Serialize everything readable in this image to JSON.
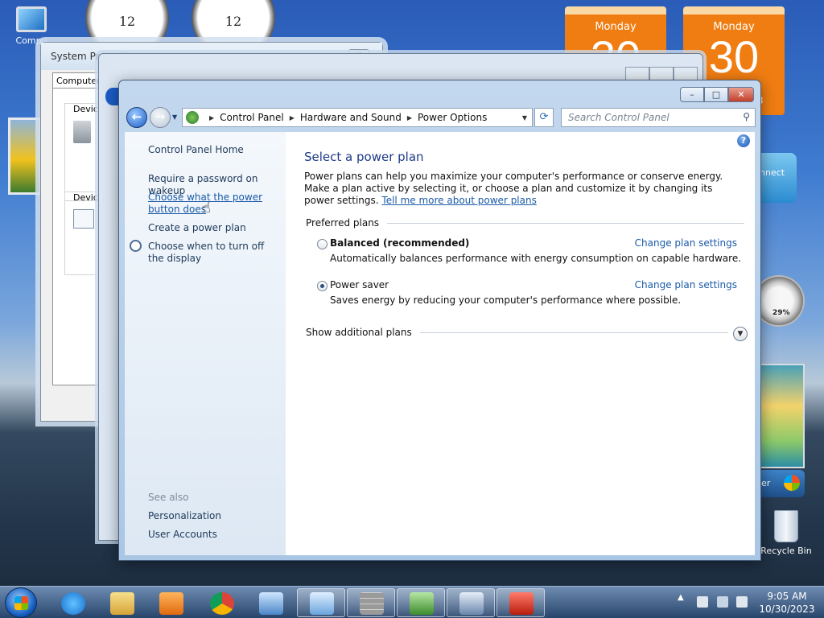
{
  "desktop": {
    "computer_label": "Compu",
    "recycle_label": "Recycle Bin",
    "clock1_num": "12",
    "clock2_num": "12",
    "calendar1": {
      "day": "Monday",
      "date": "30"
    },
    "calendar2": {
      "day": "Monday",
      "date": "30"
    },
    "calendar_fragment": "3",
    "connect_label": "nnect",
    "gauge_text": "29%",
    "media_label": "er"
  },
  "system_properties": {
    "title": "System Properties",
    "tab": "Computer N",
    "group1": "Device",
    "group2": "Device"
  },
  "window": {
    "caption": {
      "minimize": "–",
      "maximize": "□",
      "close": "✕"
    },
    "address": {
      "crumbs": [
        "Control Panel",
        "Hardware and Sound",
        "Power Options"
      ]
    },
    "search_placeholder": "Search Control Panel",
    "left_pane": {
      "home": "Control Panel Home",
      "links": [
        "Require a password on wakeup",
        "Choose what the power button does",
        "Create a power plan",
        "Choose when to turn off the display"
      ],
      "see_also": "See also",
      "see_also_links": [
        "Personalization",
        "User Accounts"
      ]
    },
    "main": {
      "title": "Select a power plan",
      "intro": "Power plans can help you maximize your computer's performance or conserve energy. Make a plan active by selecting it, or choose a plan and customize it by changing its power settings.",
      "intro_link": "Tell me more about power plans",
      "preferred_header": "Preferred plans",
      "plans": [
        {
          "name": "Balanced (recommended)",
          "desc": "Automatically balances performance with energy consumption on capable hardware.",
          "link": "Change plan settings",
          "selected": false
        },
        {
          "name": "Power saver",
          "desc": "Saves energy by reducing your computer's performance where possible.",
          "link": "Change plan settings",
          "selected": true
        }
      ],
      "additional": "Show additional plans"
    }
  },
  "taskbar": {
    "pinned": [
      "Internet Explorer",
      "Windows Explorer",
      "Windows Media Player",
      "Google Chrome",
      "Network",
      "Control Panel",
      "Firewall",
      "Utility",
      "System",
      "Toolbox"
    ],
    "time": "9:05 AM",
    "date": "10/30/2023",
    "tray_arrow": "▲"
  }
}
